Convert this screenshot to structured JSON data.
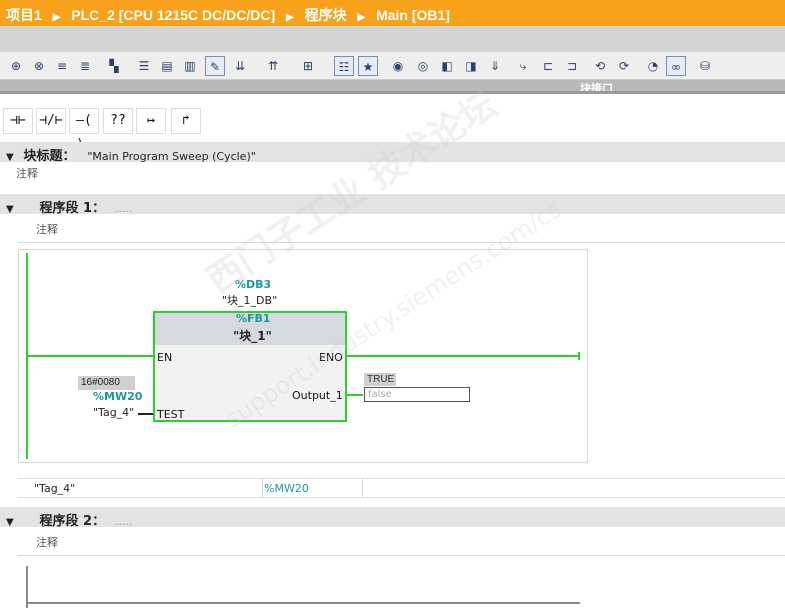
{
  "breadcrumb": {
    "project": "项目1",
    "plc": "PLC_2 [CPU 1215C DC/DC/DC]",
    "folder": "程序块",
    "block": "Main [OB1]"
  },
  "toolbar": {
    "icons": [
      "insert-network-icon",
      "delete-network-icon",
      "insert-row-icon",
      "add-row-icon",
      "reset-icon",
      "absolute-operands-icon",
      "favorites-icon",
      "comments-icon",
      "expand-networks-icon",
      "collapse-networks-icon",
      "abs-symbol-icon",
      "network-comments-icon",
      "watch-icon",
      "instance-icon",
      "breakpoint-icon",
      "step-icon",
      "call-icon",
      "goto-icon",
      "goto-next-icon",
      "jump-icon",
      "monitor-icon",
      "pin-icon",
      "test-icon",
      "monitor-on-icon",
      "memory-icon"
    ],
    "interface_label": "块接口"
  },
  "ladder_tools": [
    {
      "name": "no-contact-button",
      "label": "⊣⊢"
    },
    {
      "name": "nc-contact-button",
      "label": "⊣/⊢"
    },
    {
      "name": "coil-button",
      "label": "–( )–"
    },
    {
      "name": "empty-box-button",
      "label": "??"
    },
    {
      "name": "open-branch-button",
      "label": "↦"
    },
    {
      "name": "close-branch-button",
      "label": "↱"
    }
  ],
  "block_title": {
    "label": "块标题：",
    "value": "\"Main Program Sweep (Cycle)\"",
    "comment": "注释"
  },
  "networks": [
    {
      "label": "程序段 1：",
      "dots": ".....",
      "comment": "注释"
    },
    {
      "label": "程序段 2：",
      "dots": ".....",
      "comment": "注释"
    }
  ],
  "fb_call": {
    "instance_address": "%DB3",
    "instance_name": "\"块_1_DB\"",
    "fb_address": "%FB1",
    "fb_name": "\"块_1\"",
    "pin_en": "EN",
    "pin_eno": "ENO",
    "pin_test": "TEST",
    "pin_output": "Output_1",
    "test_value": "16#0080",
    "test_address": "%MW20",
    "test_tag": "\"Tag_4\"",
    "output_monitor": "TRUE",
    "output_field": "false"
  },
  "tag_table": {
    "name": "\"Tag_4\"",
    "address": "%MW20"
  },
  "watermark": {
    "line1": "西门子工业  技术论坛",
    "line2": "support.industry.siemens.com/cs"
  },
  "colors": {
    "title_bar": "#f7a21a",
    "power_flow": "#2dd12d",
    "address_teal": "#1a9a9a"
  }
}
